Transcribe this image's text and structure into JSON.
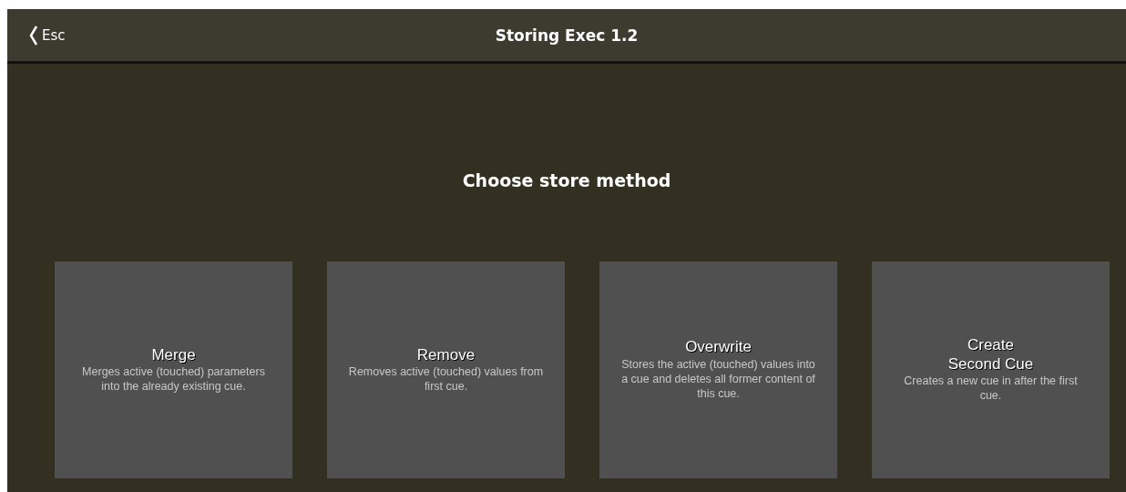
{
  "header": {
    "back_label": "Esc",
    "title": "Storing Exec 1.2"
  },
  "prompt": "Choose store method",
  "options": [
    {
      "title": "Merge",
      "description": "Merges active (touched) parameters into the already existing cue."
    },
    {
      "title": "Remove",
      "description": "Removes active (touched) values from first cue."
    },
    {
      "title": "Overwrite",
      "description": "Stores the active (touched) values into a cue and deletes all former content of this cue."
    },
    {
      "title": "Create\nSecond Cue",
      "description": "Creates a new cue in after the first cue."
    }
  ]
}
